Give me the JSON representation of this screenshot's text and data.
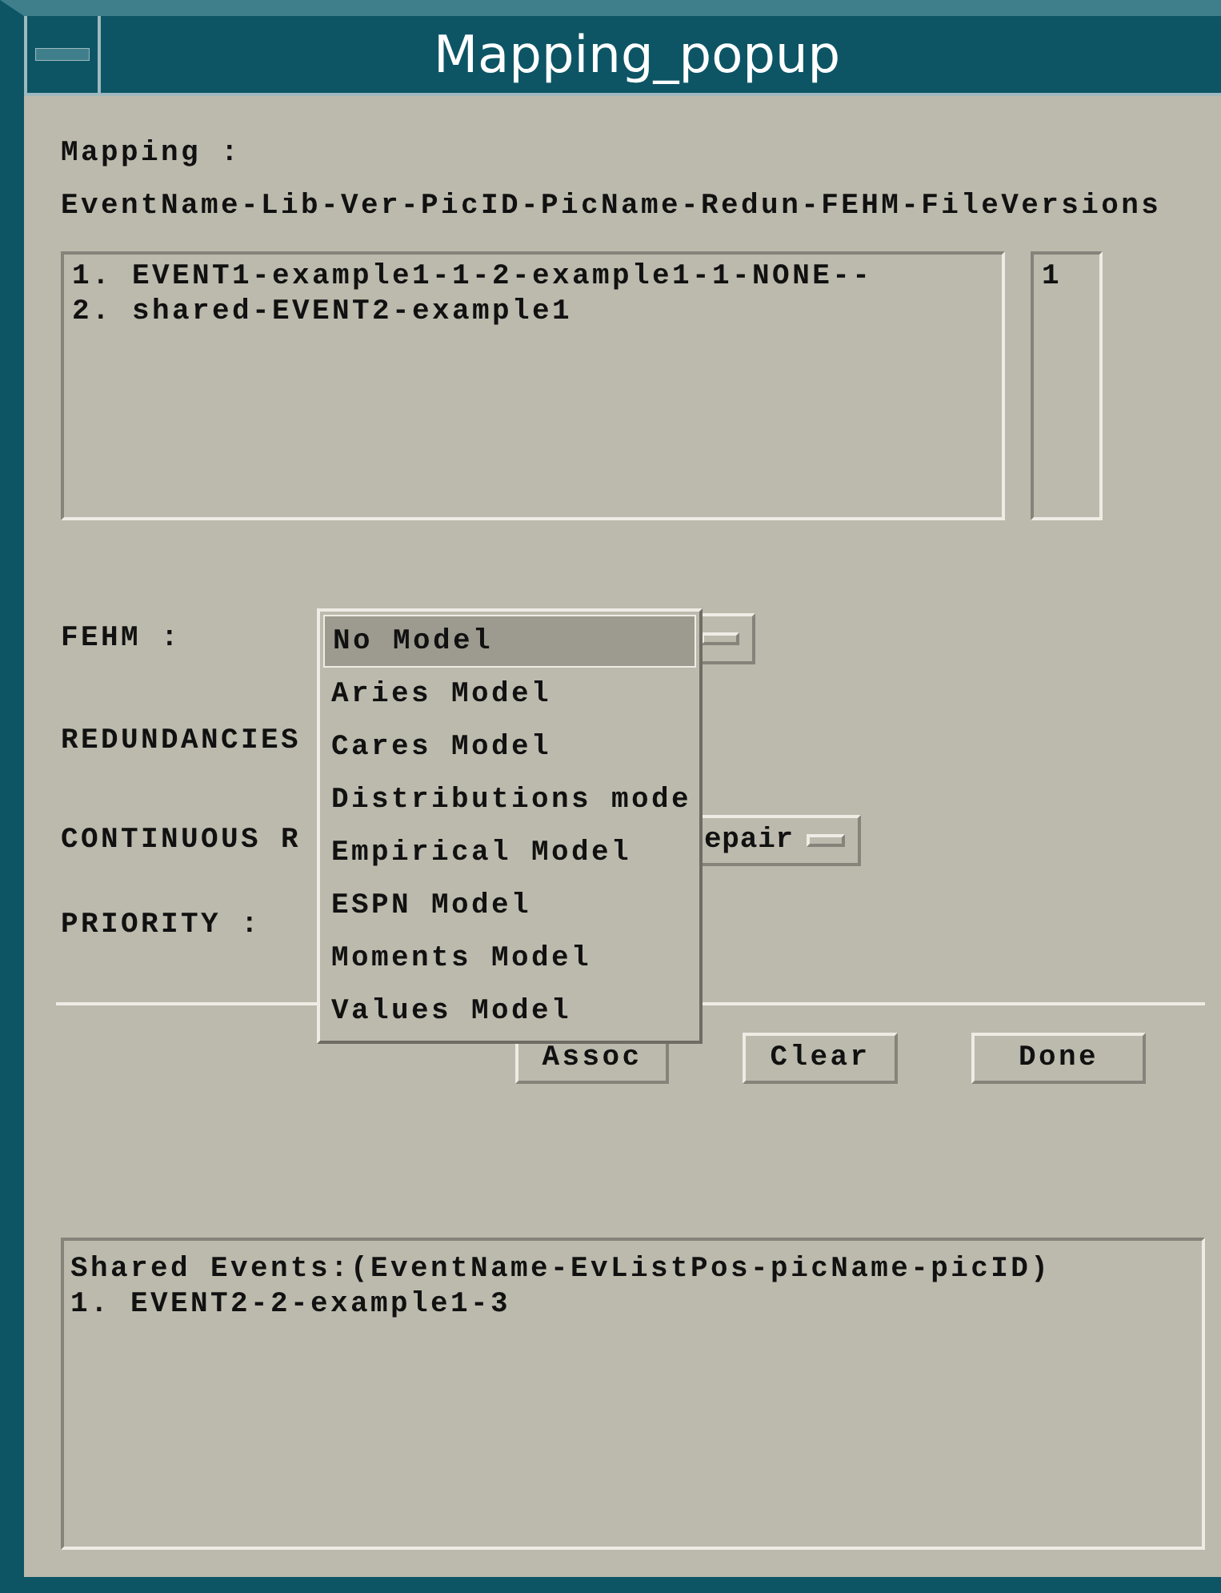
{
  "window": {
    "title": "Mapping_popup"
  },
  "mapping": {
    "label": "Mapping :",
    "format": "EventName-Lib-Ver-PicID-PicName-Redun-FEHM-FileVersions"
  },
  "event_list": {
    "items": [
      "1. EVENT1-example1-1-2-example1-1-NONE--",
      "2. shared-EVENT2-example1"
    ]
  },
  "side_list": {
    "items": [
      "1"
    ]
  },
  "fields": [
    {
      "label": "FEHM :",
      "kind": "option"
    },
    {
      "label": "REDUNDANCIES",
      "kind": "label"
    },
    {
      "label": "CONTINUOUS R",
      "kind": "option",
      "value": "epair"
    },
    {
      "label": "PRIORITY :",
      "kind": "label"
    }
  ],
  "buttons": [
    "Assoc",
    "Clear",
    "Done"
  ],
  "menu": {
    "items": [
      {
        "label": "No Model",
        "selected": true
      },
      {
        "label": "Aries Model",
        "selected": false
      },
      {
        "label": "Cares Model",
        "selected": false
      },
      {
        "label": "Distributions mode",
        "selected": false
      },
      {
        "label": "Empirical Model",
        "selected": false
      },
      {
        "label": "ESPN Model",
        "selected": false
      },
      {
        "label": "Moments Model",
        "selected": false
      },
      {
        "label": "Values Model",
        "selected": false
      }
    ]
  },
  "shared_events": {
    "items": [
      "Shared Events:(EventName-EvListPos-picName-picID)",
      "1. EVENT2-2-example1-3"
    ]
  }
}
